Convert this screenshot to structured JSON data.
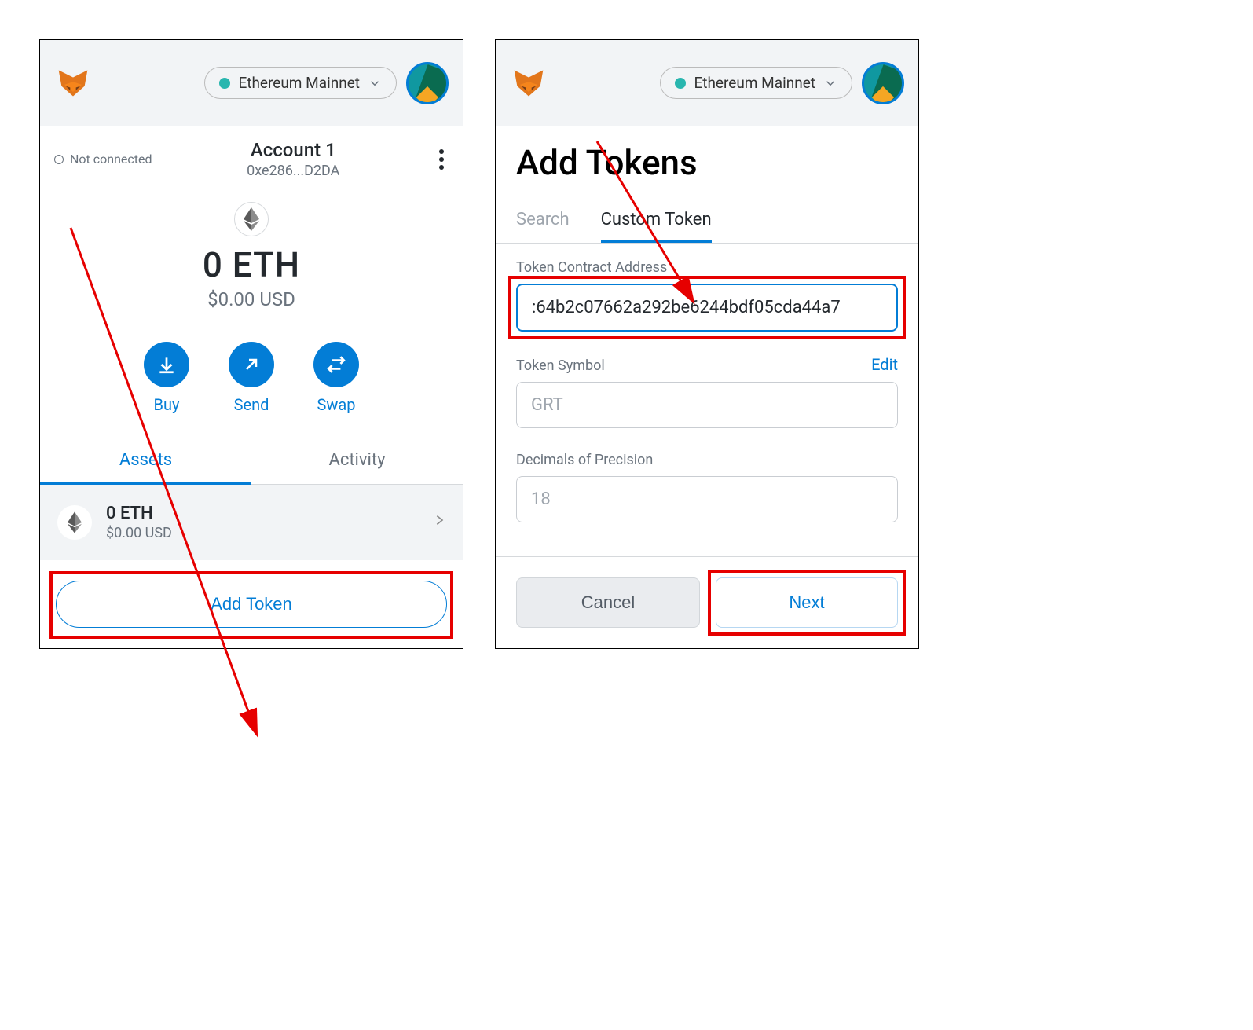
{
  "left": {
    "network_label": "Ethereum Mainnet",
    "not_connected": "Not connected",
    "account_name": "Account 1",
    "account_addr": "0xe286...D2DA",
    "balance_eth": "0 ETH",
    "balance_usd": "$0.00 USD",
    "actions": {
      "buy": "Buy",
      "send": "Send",
      "swap": "Swap"
    },
    "tabs": {
      "assets": "Assets",
      "activity": "Activity"
    },
    "asset": {
      "amount": "0 ETH",
      "usd": "$0.00 USD"
    },
    "add_token": "Add Token"
  },
  "right": {
    "network_label": "Ethereum Mainnet",
    "title": "Add Tokens",
    "tabs": {
      "search": "Search",
      "custom": "Custom Token"
    },
    "contract_label": "Token Contract Address",
    "contract_value": ":64b2c07662a292be6244bdf05cda44a7",
    "symbol_label": "Token Symbol",
    "edit": "Edit",
    "symbol_value": "GRT",
    "decimals_label": "Decimals of Precision",
    "decimals_value": "18",
    "cancel": "Cancel",
    "next": "Next"
  }
}
